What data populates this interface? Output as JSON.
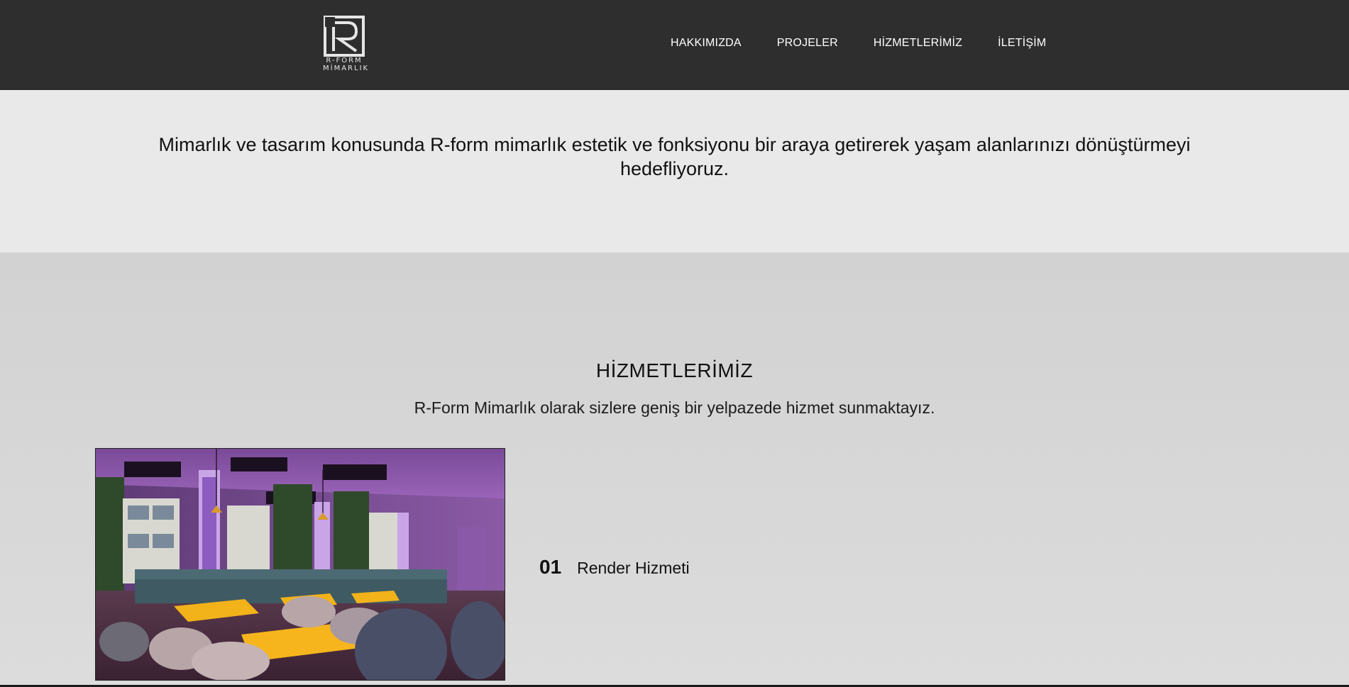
{
  "logo": {
    "line1": "R-FORM",
    "line2": "MİMARLIK"
  },
  "nav": {
    "items": [
      {
        "label": "HAKKIMIZDA"
      },
      {
        "label": "PROJELER"
      },
      {
        "label": "HİZMETLERİMİZ"
      },
      {
        "label": "İLETİŞİM"
      }
    ]
  },
  "intro": {
    "text": "Mimarlık ve tasarım konusunda R-form mimarlık estetik ve fonksiyonu bir araya getirerek yaşam alanlarınızı dönüştürmeyi hedefliyoruz."
  },
  "services": {
    "title": "HİZMETLERİMİZ",
    "subtitle": "R-Form Mimarlık olarak sizlere geniş bir yelpazede hizmet sunmaktayız.",
    "items": [
      {
        "number": "01",
        "label": "Render Hizmeti"
      }
    ]
  },
  "colors": {
    "header_bg": "#2e2e2e",
    "intro_bg": "#e9e9e9",
    "services_bg": "#d4d4d4",
    "text": "#111111"
  }
}
